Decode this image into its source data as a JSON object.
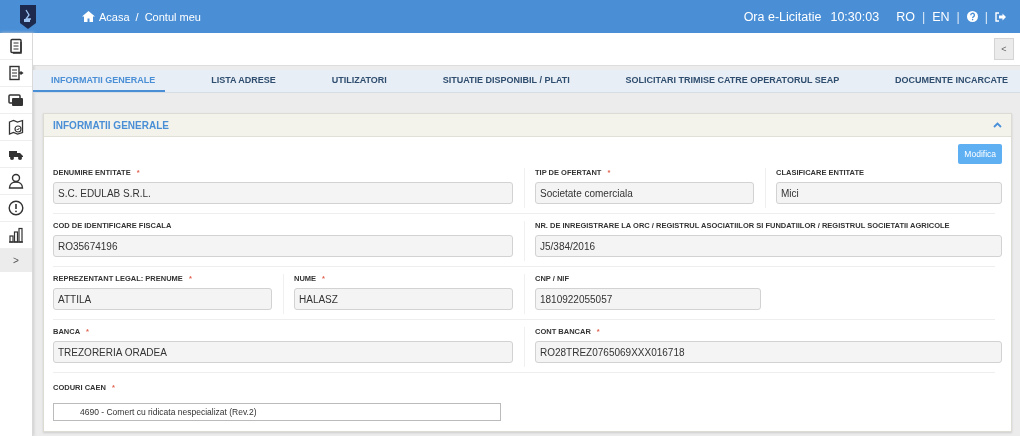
{
  "header": {
    "breadcrumb": [
      {
        "label": "Acasa",
        "kind": "home"
      },
      {
        "label": "/",
        "kind": "separator"
      },
      {
        "label": "Contul meu",
        "kind": "link"
      }
    ],
    "clock_label": "Ora e-Licitatie",
    "clock_time": "10:30:03",
    "nav": [
      {
        "kind": "text",
        "label": "RO"
      },
      {
        "kind": "separator",
        "label": "|"
      },
      {
        "kind": "text",
        "label": "EN"
      },
      {
        "kind": "separator",
        "label": "|"
      },
      {
        "kind": "help"
      },
      {
        "kind": "separator",
        "label": "|"
      },
      {
        "kind": "logout"
      }
    ]
  },
  "sidebar": {
    "items": [
      {
        "kind": "document"
      },
      {
        "kind": "list"
      },
      {
        "kind": "cards"
      },
      {
        "kind": "map"
      },
      {
        "kind": "truck"
      },
      {
        "kind": "user"
      },
      {
        "kind": "alert"
      },
      {
        "kind": "chart"
      }
    ],
    "expand": ">"
  },
  "collapse_button": "<",
  "tabs": [
    {
      "label": "INFORMATII GENERALE",
      "selected": true
    },
    {
      "label": "LISTA ADRESE",
      "selected": false
    },
    {
      "label": "UTILIZATORI",
      "selected": false
    },
    {
      "label": "SITUATIE DISPONIBIL / PLATI",
      "selected": false
    },
    {
      "label": "SOLICITARI TRIMISE CATRE OPERATORUL SEAP",
      "selected": false
    },
    {
      "label": "DOCUMENTE INCARCATE",
      "selected": false
    }
  ],
  "panel": {
    "title": "INFORMATII GENERALE",
    "expanded": true,
    "edit_button": "Modifica",
    "rows": [
      {
        "fields": [
          {
            "label": "DENUMIRE ENTITATE",
            "required_mark": "*",
            "value": "S.C. EDULAB S.R.L."
          },
          {
            "label": "TIP DE OFERTANT",
            "required_mark": "*",
            "value": "Societate comerciala"
          },
          {
            "label": "CLASIFICARE ENTITATE",
            "value": "Mici"
          }
        ]
      },
      {
        "fields": [
          {
            "label": "COD DE IDENTIFICARE FISCALA",
            "value": "RO35674196"
          },
          {
            "label": "NR. DE INREGISTRARE LA ORC / REGISTRUL ASOCIATIILOR SI FUNDATIILOR / REGISTRUL SOCIETATII AGRICOLE",
            "value": "J5/384/2016"
          }
        ]
      },
      {
        "fields": [
          {
            "label": "REPREZENTANT LEGAL: PRENUME",
            "required_mark": "*",
            "value": "ATTILA"
          },
          {
            "label": "NUME",
            "required_mark": "*",
            "value": "HALASZ"
          },
          {
            "label": "CNP / NIF",
            "value": "1810922055057"
          }
        ]
      },
      {
        "fields": [
          {
            "label": "BANCA",
            "required_mark": "*",
            "value": "TREZORERIA ORADEA"
          },
          {
            "label": "CONT BANCAR",
            "required_mark": "*",
            "value": "RO28TREZ0765069XXX016718"
          }
        ]
      }
    ],
    "caen": {
      "label": "CODURI CAEN",
      "required_mark": "*",
      "value": "4690 - Comert cu ridicata nespecializat (Rev.2)"
    }
  }
}
